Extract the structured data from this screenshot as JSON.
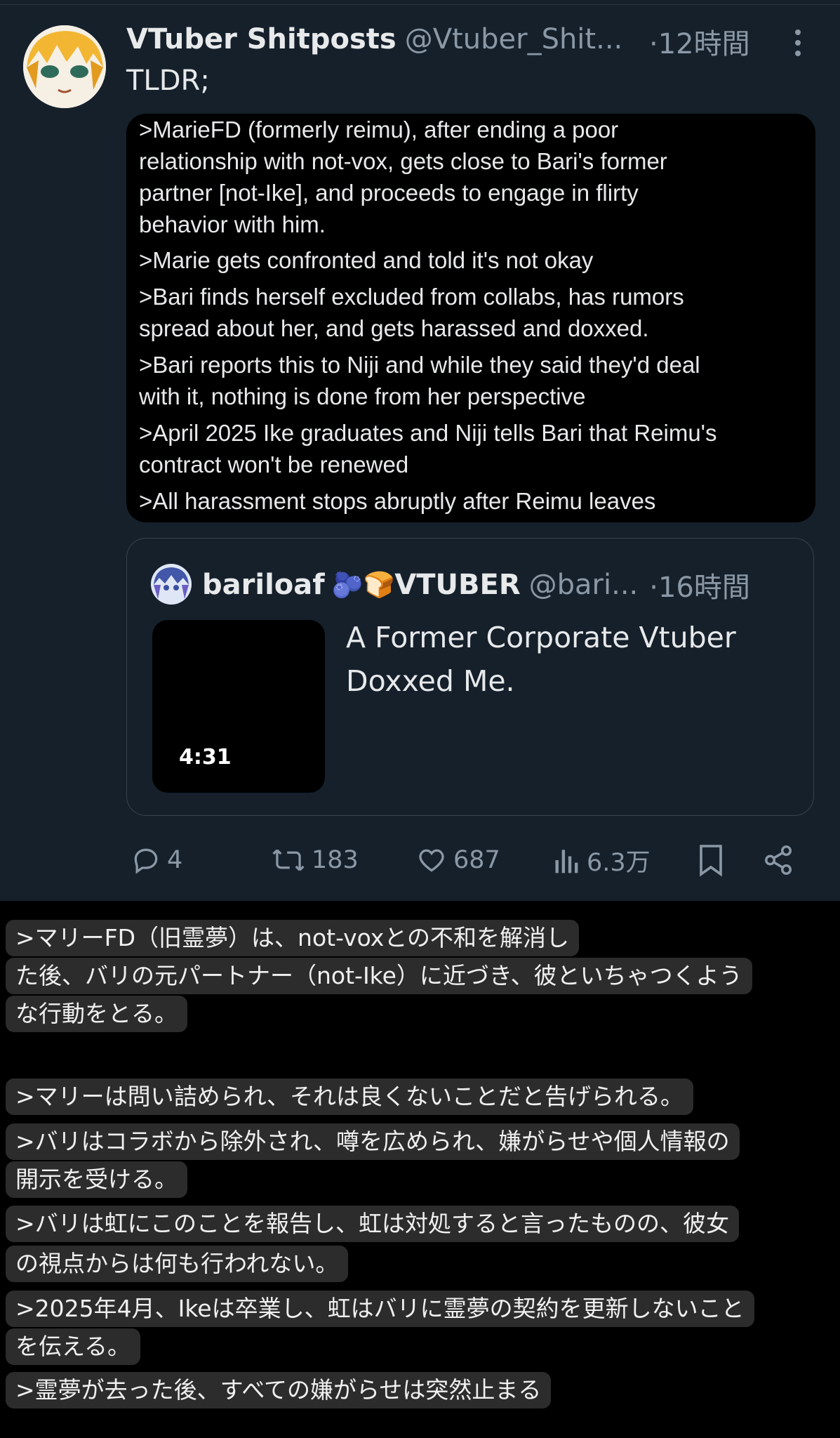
{
  "tweet": {
    "display_name": "VTuber Shitposts",
    "handle": "@Vtuber_Shit...",
    "time": "·12時間",
    "text": "TLDR;",
    "image_lines": [
      ">MarieFD (formerly reimu), after ending a poor",
      "relationship with not-vox, gets close to Bari's former",
      "partner [not-Ike], and proceeds to engage in flirty",
      "behavior with him.",
      ">Marie gets confronted and told it's not okay",
      ">Bari finds herself excluded from collabs, has rumors",
      "spread about her, and gets harassed and doxxed.",
      ">Bari reports this to Niji and while they said they'd deal",
      "with it, nothing is done from her perspective",
      ">April 2025 Ike graduates and Niji tells Bari that Reimu's",
      "contract won't be renewed",
      ">All harassment stops abruptly after Reimu leaves"
    ]
  },
  "quote": {
    "display_name": "bariloaf",
    "emoji": "🫐🍞",
    "name_suffix": "VTUBER",
    "handle": "@bari...",
    "time": "·16時間",
    "video_duration": "4:31",
    "title_line1": "A Former Corporate Vtuber",
    "title_line2": "Doxxed Me."
  },
  "actions": {
    "replies": "4",
    "retweets": "183",
    "likes": "687",
    "views": "6.3万"
  },
  "translation_lines": [
    ">マリーFD（旧霊夢）は、not-voxとの不和を解消し",
    "た後、バリの元パートナー（not-Ike）に近づき、彼といちゃつくよう",
    "な行動をとる。",
    ">マリーは問い詰められ、それは良くないことだと告げられる。",
    ">バリはコラボから除外され、噂を広められ、嫌がらせや個人情報の",
    "開示を受ける。",
    ">バリは虹にこのことを報告し、虹は対処すると言ったものの、彼女",
    "の視点からは何も行われない。",
    ">2025年4月、Ikeは卒業し、虹はバリに霊夢の契約を更新しないこと",
    "を伝える。",
    ">霊夢が去った後、すべての嫌がらせは突然止まる"
  ],
  "colors": {
    "tweet_bg": "#15202b",
    "text": "#e7e9ea",
    "secondary": "#8b98a5",
    "subtitle_bg": "#2c2c2c"
  }
}
